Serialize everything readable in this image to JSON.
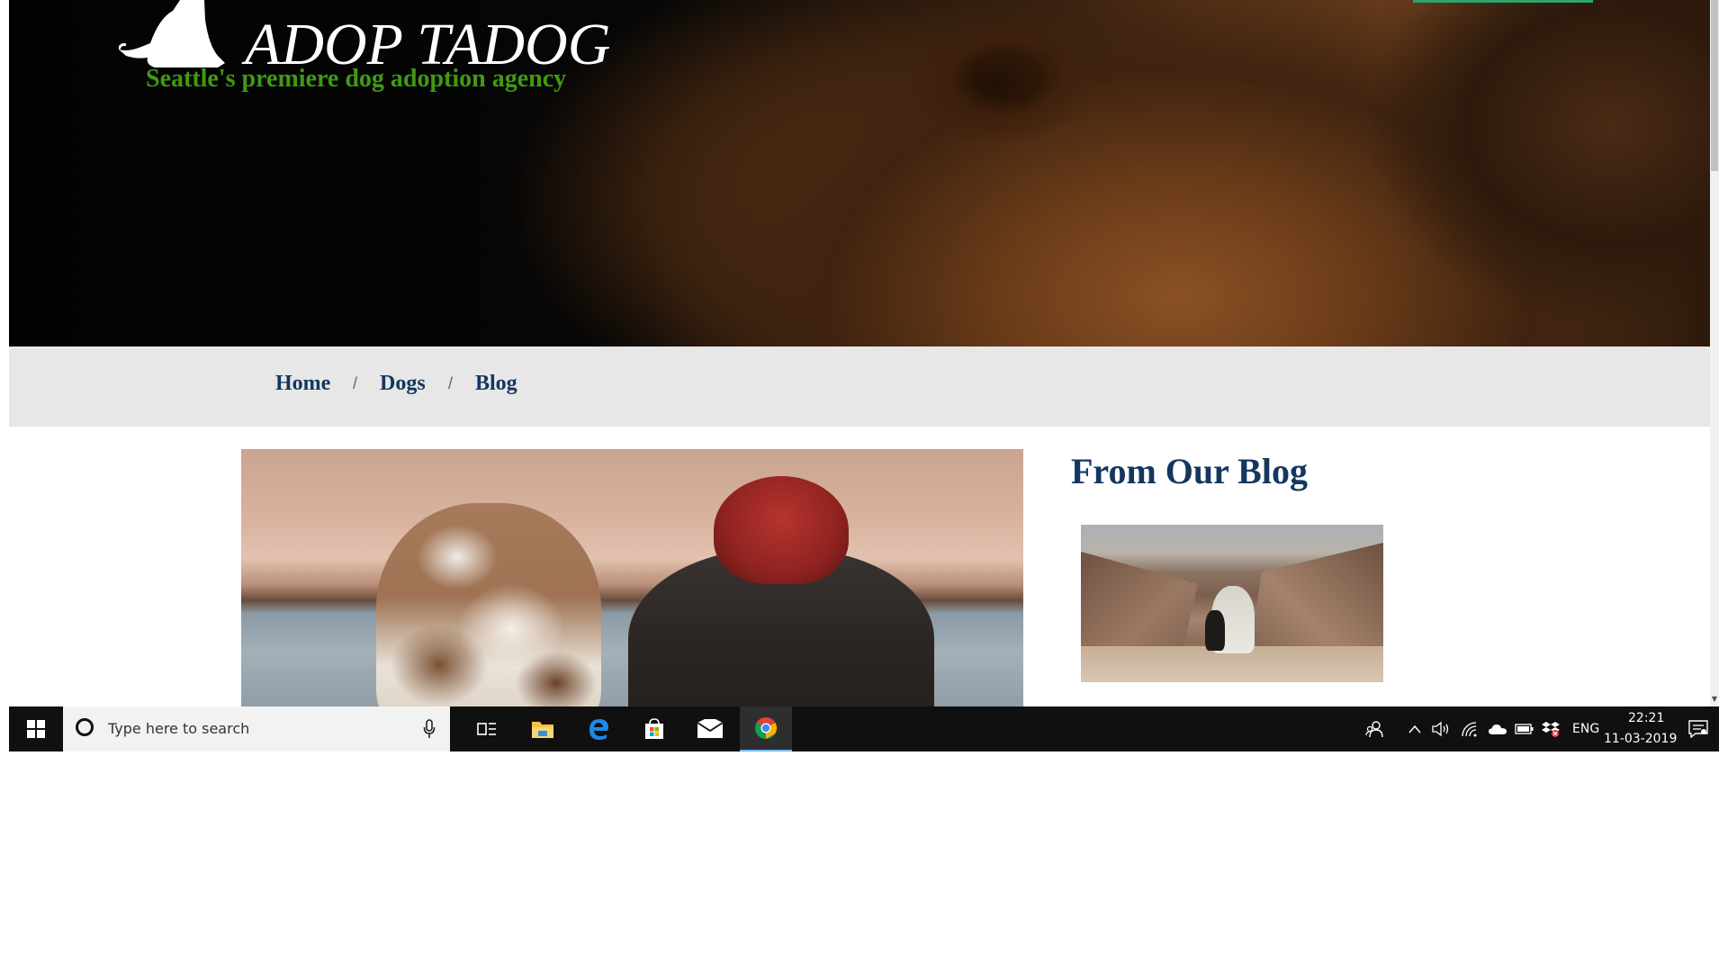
{
  "site": {
    "brand": "ADOP TADOG",
    "tagline": "Seattle's premiere dog adoption agency"
  },
  "nav": {
    "items": [
      {
        "label": "Home"
      },
      {
        "label": "Dogs"
      },
      {
        "label": "Blog"
      }
    ],
    "separator": "/"
  },
  "blog": {
    "heading": "From Our Blog"
  },
  "taskbar": {
    "search_placeholder": "Type here to search",
    "language": "ENG",
    "time": "22:21",
    "date": "11-03-2019",
    "pinned": [
      {
        "icon": "task-view-icon"
      },
      {
        "icon": "file-explorer-icon"
      },
      {
        "icon": "edge-icon"
      },
      {
        "icon": "store-icon"
      },
      {
        "icon": "mail-icon"
      },
      {
        "icon": "chrome-icon",
        "active": true
      }
    ],
    "tray": [
      "people-icon",
      "chevron-up-icon",
      "volume-icon",
      "wifi-icon",
      "onedrive-icon",
      "battery-icon",
      "dropbox-icon",
      "notifications-icon"
    ]
  },
  "colors": {
    "nav_text": "#143760",
    "tagline": "#3f9a12",
    "nav_bg": "#e7e7e7",
    "taskbar_bg": "#101010"
  }
}
